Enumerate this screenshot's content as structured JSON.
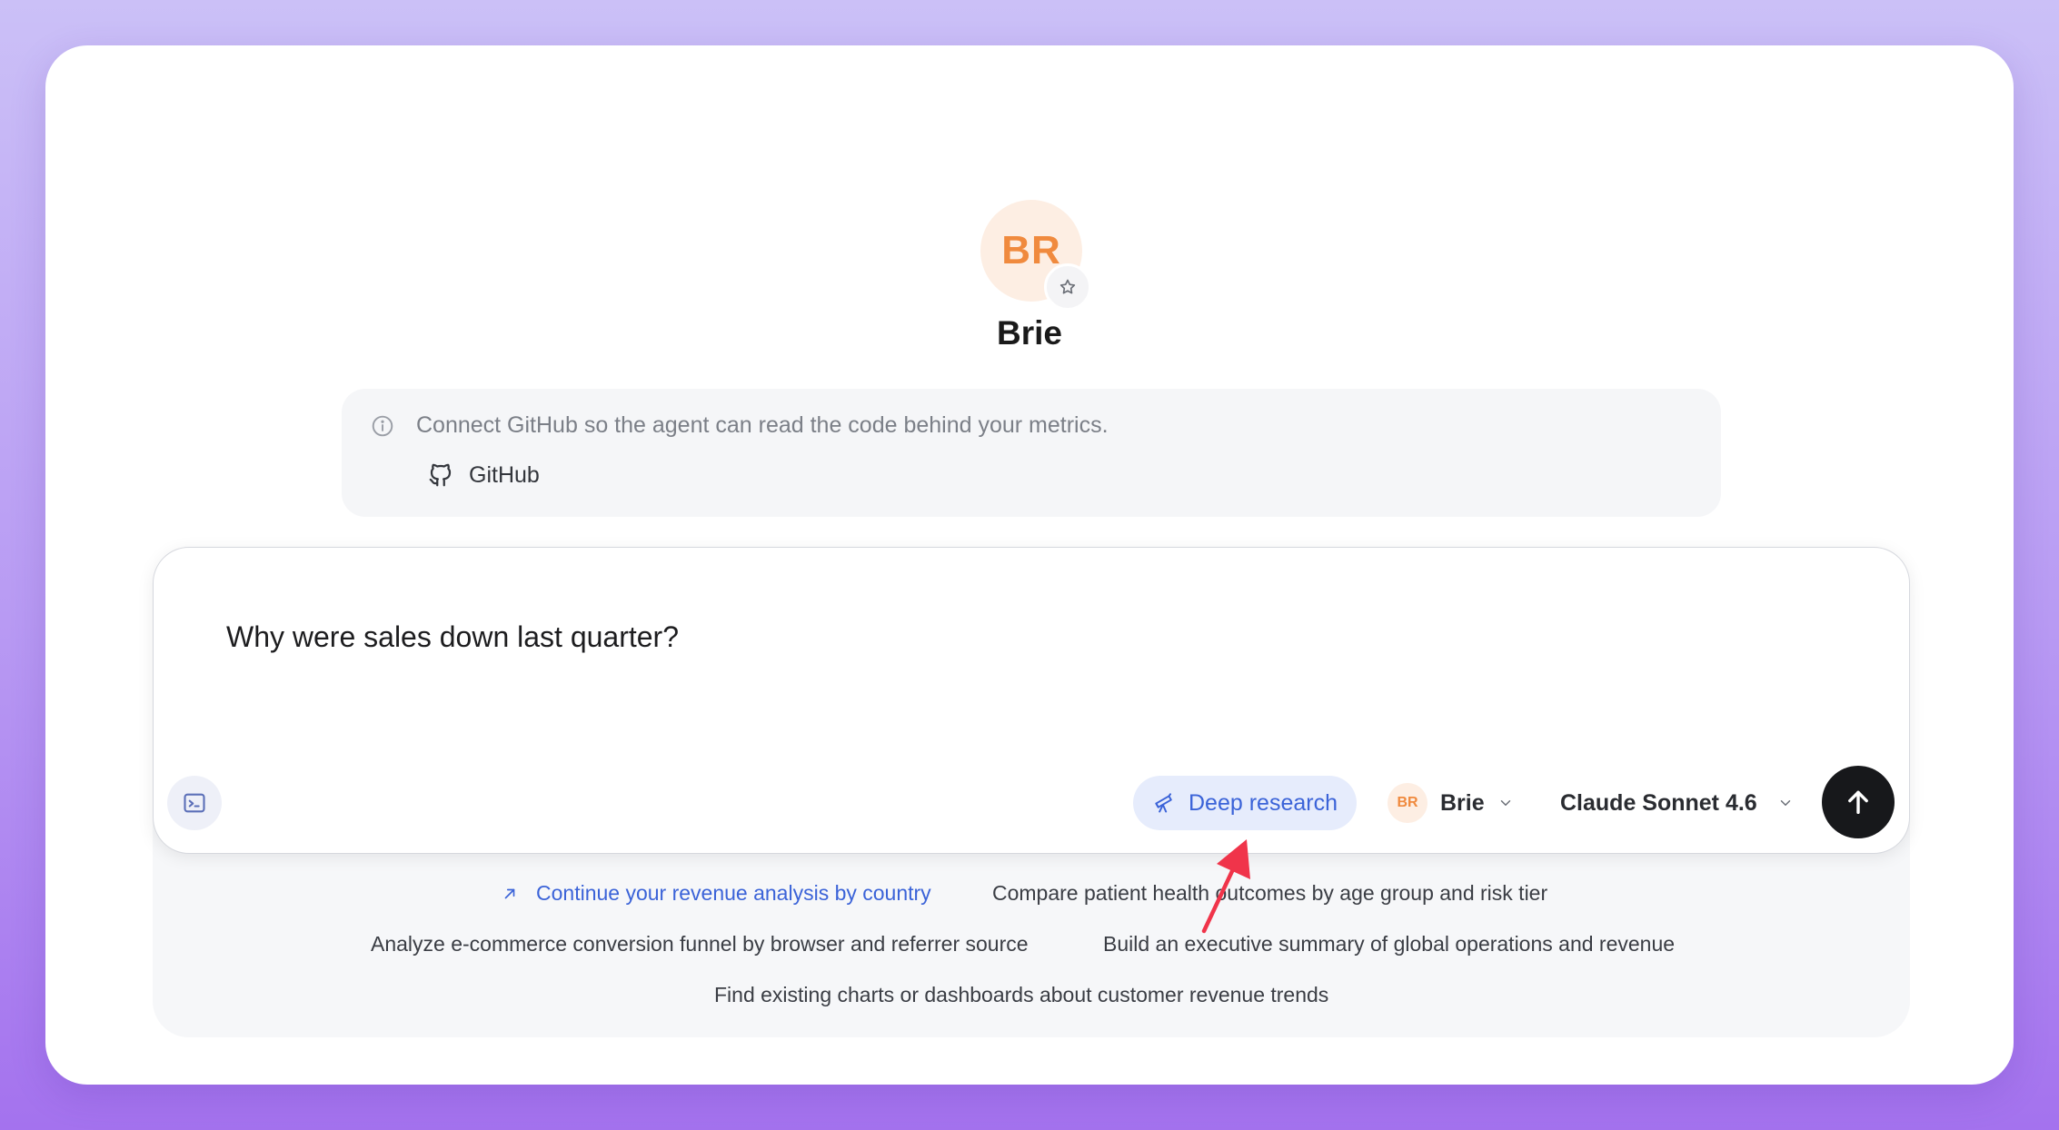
{
  "agent": {
    "initials": "BR",
    "name": "Brie"
  },
  "notice": {
    "text": "Connect GitHub so the agent can read the code behind your metrics.",
    "github_label": "GitHub"
  },
  "composer": {
    "prompt": "Why were sales down last quarter?",
    "deep_research_label": "Deep research",
    "agent_select_initials": "BR",
    "agent_select_label": "Brie",
    "model_label": "Claude Sonnet 4.6"
  },
  "suggestions": {
    "continue": "Continue your revenue analysis by country",
    "patient": "Compare patient health outcomes by age group and risk tier",
    "ecommerce": "Analyze e-commerce conversion funnel by browser and referrer source",
    "executive": "Build an executive summary of global operations and revenue",
    "charts": "Find existing charts or dashboards about customer revenue trends"
  },
  "icons": {
    "avatar_badge": "star-icon",
    "notice": "info-icon",
    "github": "github-icon",
    "terminal": "terminal-icon",
    "deep_research": "telescope-icon",
    "dropdown": "chevron-down-icon",
    "send": "arrow-up-icon",
    "continue": "arrow-up-right-icon"
  },
  "colors": {
    "accent_blue": "#3b63d8",
    "avatar_orange": "#f08a3e",
    "annotation_red": "#f0344a"
  }
}
